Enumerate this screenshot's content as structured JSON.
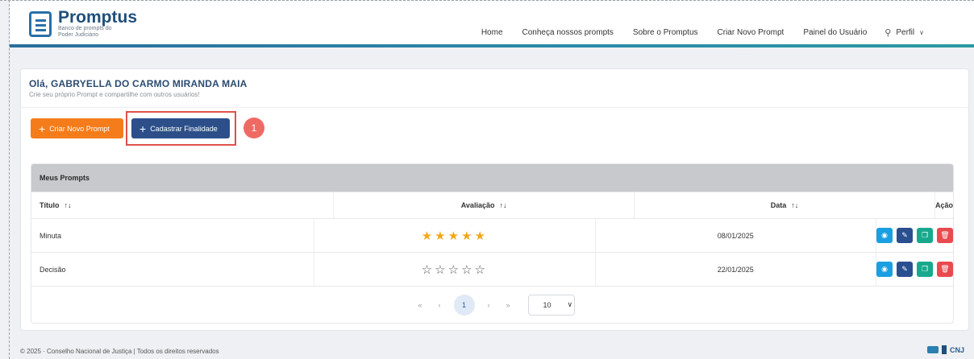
{
  "brand": {
    "name": "Promptus",
    "subtitle": "Banco de prompts do Poder Judiciário"
  },
  "nav": {
    "items": [
      "Home",
      "Conheça nossos prompts",
      "Sobre o Promptus",
      "Criar Novo Prompt",
      "Painel do Usuário"
    ],
    "profile_label": "Perfil"
  },
  "greeting": {
    "title": "Olá, GABRYELLA DO CARMO MIRANDA MAIA",
    "subtitle": "Crie seu próprio Prompt e compartilhe com outros usuários!"
  },
  "actions": {
    "create_prompt": "Criar Novo Prompt",
    "register_purpose": "Cadastrar Finalidade",
    "annotation_number": "1"
  },
  "table": {
    "caption": "Meus Prompts",
    "columns": [
      "Título",
      "Avaliação",
      "Data",
      "Ação"
    ],
    "rows": [
      {
        "title": "Minuta",
        "rating": 5,
        "date": "08/01/2025"
      },
      {
        "title": "Decisão",
        "rating": 0,
        "date": "22/01/2025"
      }
    ]
  },
  "pagination": {
    "current_page": "1",
    "per_page": "10"
  },
  "footer": {
    "text": "© 2025 · Conselho Nacional de Justiça | Todos os direitos reservados",
    "logo_text": "CNJ"
  },
  "colors": {
    "orange": "#f47c1a",
    "primary_blue": "#2c4f8a",
    "view": "#1a9fe0",
    "copy": "#18a98d",
    "delete": "#e94a4f",
    "star": "#f0a818"
  }
}
